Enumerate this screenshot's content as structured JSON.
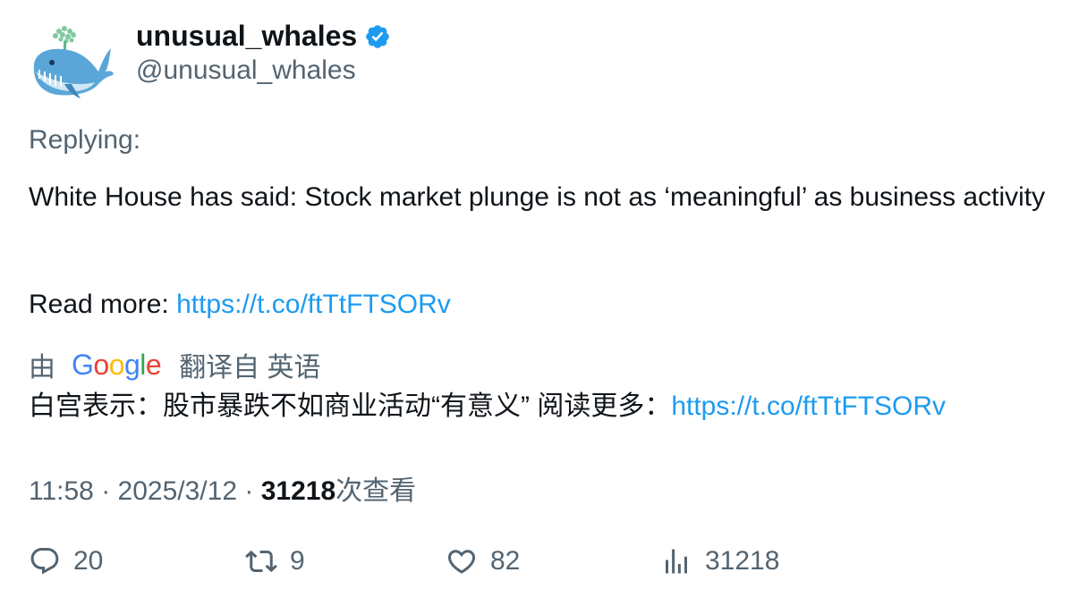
{
  "author": {
    "display_name": "unusual_whales",
    "handle": "@unusual_whales",
    "verified": true
  },
  "replying_label": "Replying:",
  "tweet": {
    "text": "White House has said: Stock market plunge is not as ‘meaningful’ as business activity",
    "read_more_label": "Read more: ",
    "link": "https://t.co/ftTtFTSORv"
  },
  "translation": {
    "by_label": "由",
    "provider": "Google",
    "from_label": "翻译自 英语",
    "text": "白宫表示：股市暴跌不如商业活动“有意义” 阅读更多：",
    "link": "https://t.co/ftTtFTSORv"
  },
  "meta": {
    "time": "11:58",
    "date": "2025/3/12",
    "views": "31218",
    "views_label": "次查看"
  },
  "actions": {
    "replies": "20",
    "retweets": "9",
    "likes": "82",
    "views": "31218"
  },
  "colors": {
    "link": "#1d9bf0",
    "secondary": "#536471",
    "verified": "#1d9bf0"
  }
}
